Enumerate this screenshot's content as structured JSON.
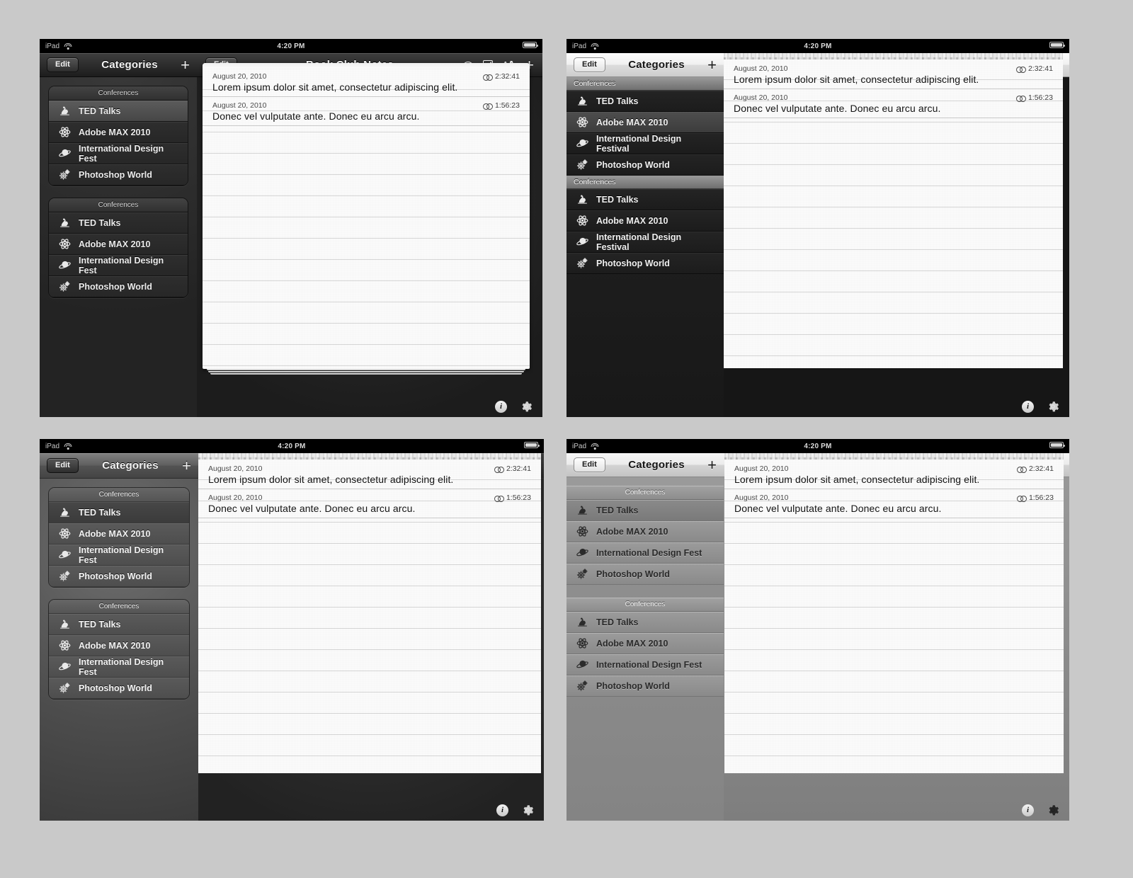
{
  "meta": {
    "background_color": "#c9c9c9",
    "panel_count": 4,
    "description": "iPad notes app UI theme comparison — four variants"
  },
  "status_bar": {
    "device_label": "iPad",
    "wifi_icon": "wifi-icon",
    "time": "4:20 PM",
    "battery_icon": "battery-icon"
  },
  "sidebar_toolbar": {
    "edit_label": "Edit",
    "title": "Categories",
    "add_label": "+",
    "add_icon": "plus-icon"
  },
  "detail_toolbar": {
    "edit_label": "Edit",
    "title": "Book Club Notes",
    "icons": [
      {
        "name": "wifi-sync-icon",
        "glyph": "wifi"
      },
      {
        "name": "share-icon",
        "glyph": "square-diagonal"
      },
      {
        "name": "text-size-icon",
        "glyph": "aA"
      },
      {
        "name": "add-note-icon",
        "glyph": "plus"
      }
    ]
  },
  "footer": {
    "info_icon": "info-icon",
    "info_glyph": "i",
    "settings_icon": "gear-icon"
  },
  "note_entries": [
    {
      "date": "August 20, 2010",
      "time": "2:32:41",
      "link_icon": "chain-link-icon",
      "text": "Lorem ipsum dolor sit amet, consectetur adipiscing elit."
    },
    {
      "date": "August 20, 2010",
      "time": "1:56:23",
      "link_icon": "chain-link-icon",
      "text": "Donec vel vulputate ante. Donec eu arcu arcu."
    }
  ],
  "category_group_header": "Conferences",
  "category_items_short": [
    {
      "label": "TED Talks",
      "icon": "ted-talks-icon",
      "selected": true
    },
    {
      "label": "Adobe MAX 2010",
      "icon": "atom-icon",
      "selected": false
    },
    {
      "label": "International Design Fest",
      "icon": "planet-saturn-icon",
      "selected": false
    },
    {
      "label": "Photoshop World",
      "icon": "gears-icon",
      "selected": false
    }
  ],
  "category_items_short_2": [
    {
      "label": "TED Talks",
      "icon": "ted-talks-icon",
      "selected": false
    },
    {
      "label": "Adobe MAX 2010",
      "icon": "atom-icon",
      "selected": false
    },
    {
      "label": "International Design Fest",
      "icon": "planet-saturn-icon",
      "selected": false
    },
    {
      "label": "Photoshop World",
      "icon": "gears-icon",
      "selected": false
    }
  ],
  "category_items_long": [
    {
      "label": "TED Talks",
      "icon": "ted-talks-icon",
      "selected": false
    },
    {
      "label": "Adobe MAX 2010",
      "icon": "atom-icon",
      "selected": true
    },
    {
      "label": "International Design Festival",
      "icon": "planet-saturn-icon",
      "selected": false
    },
    {
      "label": "Photoshop World",
      "icon": "gears-icon",
      "selected": false
    }
  ],
  "category_items_long_2": [
    {
      "label": "TED Talks",
      "icon": "ted-talks-icon",
      "selected": false
    },
    {
      "label": "Adobe MAX 2010",
      "icon": "atom-icon",
      "selected": false
    },
    {
      "label": "International Design Festival",
      "icon": "planet-saturn-icon",
      "selected": false
    },
    {
      "label": "Photoshop World",
      "icon": "gears-icon",
      "selected": false
    }
  ],
  "panels": [
    {
      "id": "p1",
      "theme": "dark-grouped",
      "sidebar_style": "grouped",
      "toolbar_style": "dark",
      "paper_style": "card"
    },
    {
      "id": "p2",
      "theme": "light-chrome",
      "sidebar_style": "plain",
      "toolbar_style": "light",
      "paper_style": "torn"
    },
    {
      "id": "p3",
      "theme": "mid-grey",
      "sidebar_style": "grouped",
      "toolbar_style": "grey",
      "paper_style": "flat"
    },
    {
      "id": "p4",
      "theme": "light-grey",
      "sidebar_style": "plain",
      "toolbar_style": "light",
      "paper_style": "flat"
    }
  ]
}
